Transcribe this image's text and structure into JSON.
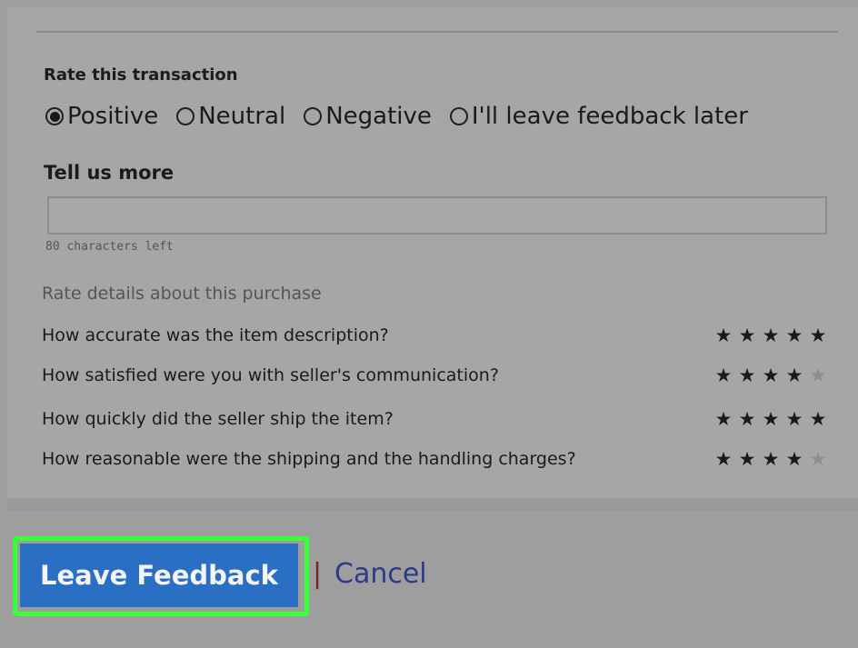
{
  "rating": {
    "heading": "Rate this transaction",
    "options": [
      {
        "label": "Positive",
        "selected": true
      },
      {
        "label": "Neutral",
        "selected": false
      },
      {
        "label": "Negative",
        "selected": false
      },
      {
        "label": "I'll leave feedback later",
        "selected": false
      }
    ]
  },
  "comment": {
    "heading": "Tell us more",
    "value": "",
    "chars_left": "80 characters left"
  },
  "details": {
    "heading": "Rate details about this purchase",
    "questions": [
      {
        "text": "How accurate was the item description?",
        "stars": 5,
        "max": 5
      },
      {
        "text": "How satisfied were you with seller's communication?",
        "stars": 4,
        "max": 5
      },
      {
        "text": "How quickly did the seller ship the item?",
        "stars": 5,
        "max": 5
      },
      {
        "text": "How reasonable were the shipping and the handling charges?",
        "stars": 4,
        "max": 5
      }
    ]
  },
  "actions": {
    "leave_label": "Leave Feedback",
    "separator": "|",
    "cancel_label": "Cancel"
  },
  "colors": {
    "button": "#2a6fc3",
    "highlight": "#39ff39",
    "link": "#2c3a8a"
  }
}
